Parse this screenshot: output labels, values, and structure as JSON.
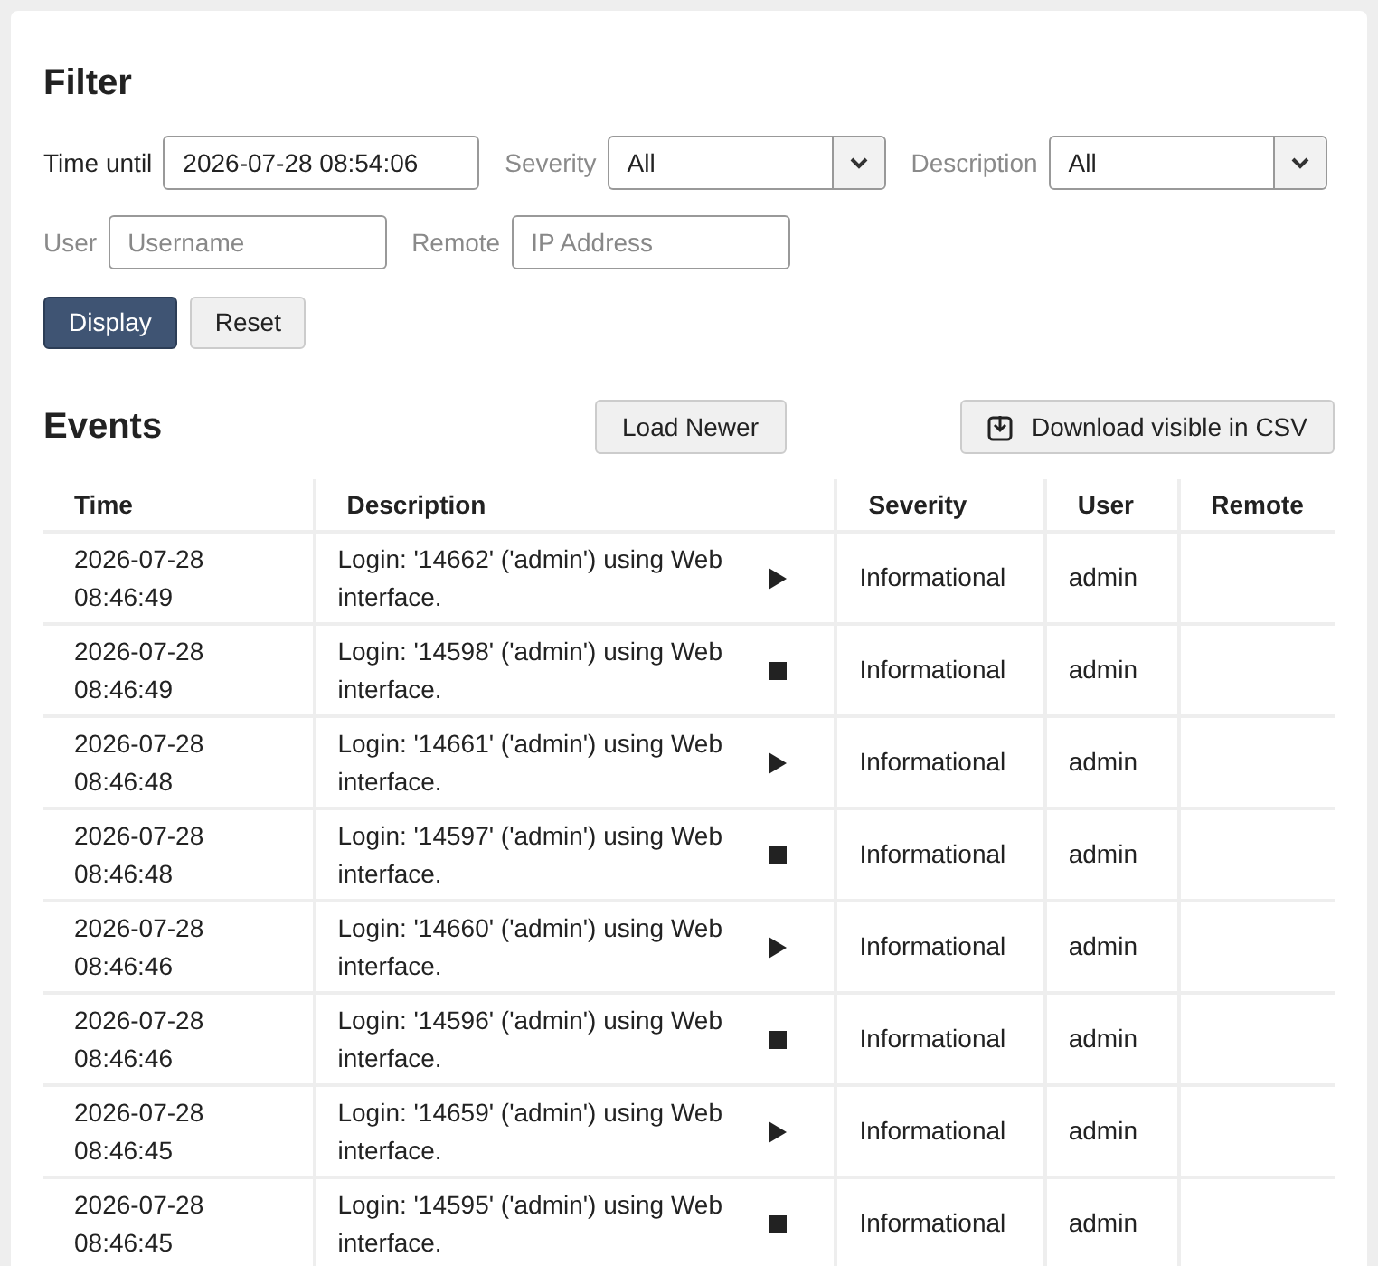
{
  "filter": {
    "title": "Filter",
    "fields": [
      {
        "kind": "text",
        "label": "Time until",
        "label_dimmed": false,
        "value": "2026-07-28 08:54:06"
      },
      {
        "kind": "select",
        "label": "Severity",
        "label_dimmed": true,
        "value": "All"
      },
      {
        "kind": "select",
        "label": "Description",
        "label_dimmed": true,
        "value": "All"
      },
      {
        "kind": "text",
        "label": "User",
        "label_dimmed": true,
        "placeholder": "Username"
      },
      {
        "kind": "text",
        "label": "Remote",
        "label_dimmed": true,
        "placeholder": "IP Address"
      }
    ],
    "buttons": [
      {
        "label": "Display",
        "primary": true
      },
      {
        "label": "Reset",
        "primary": false
      }
    ]
  },
  "events": {
    "title": "Events",
    "load_button": "Load Newer",
    "download_button": "Download visible in CSV",
    "columns": [
      "Time",
      "Description",
      "Severity",
      "User",
      "Remote"
    ],
    "rows": [
      {
        "time": "2026-07-28 08:46:49",
        "description": "Login: '14662' ('admin') using Web interface.",
        "kind": "start",
        "severity": "Informational",
        "user": "admin"
      },
      {
        "time": "2026-07-28 08:46:49",
        "description": "Login: '14598' ('admin') using Web interface.",
        "kind": "stop",
        "severity": "Informational",
        "user": "admin"
      },
      {
        "time": "2026-07-28 08:46:48",
        "description": "Login: '14661' ('admin') using Web interface.",
        "kind": "start",
        "severity": "Informational",
        "user": "admin"
      },
      {
        "time": "2026-07-28 08:46:48",
        "description": "Login: '14597' ('admin') using Web interface.",
        "kind": "stop",
        "severity": "Informational",
        "user": "admin"
      },
      {
        "time": "2026-07-28 08:46:46",
        "description": "Login: '14660' ('admin') using Web interface.",
        "kind": "start",
        "severity": "Informational",
        "user": "admin"
      },
      {
        "time": "2026-07-28 08:46:46",
        "description": "Login: '14596' ('admin') using Web interface.",
        "kind": "stop",
        "severity": "Informational",
        "user": "admin"
      },
      {
        "time": "2026-07-28 08:46:45",
        "description": "Login: '14659' ('admin') using Web interface.",
        "kind": "start",
        "severity": "Informational",
        "user": "admin"
      },
      {
        "time": "2026-07-28 08:46:45",
        "description": "Login: '14595' ('admin') using Web interface.",
        "kind": "stop",
        "severity": "Informational",
        "user": "admin"
      }
    ]
  }
}
